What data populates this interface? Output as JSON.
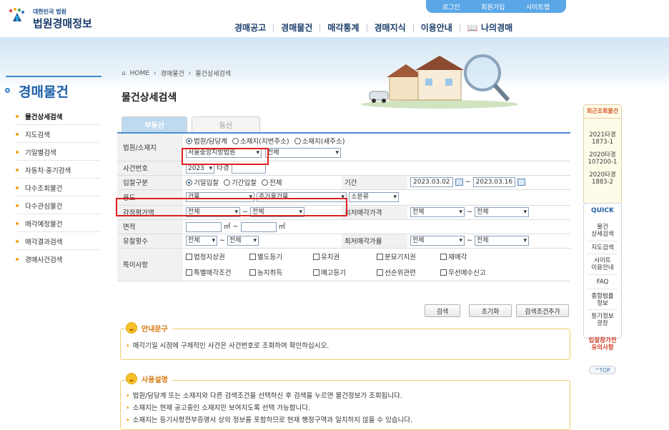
{
  "util_links": [
    "로그인",
    "회원가입",
    "사이트맵"
  ],
  "logo": {
    "small": "대한민국 법원",
    "big": "법원경매정보"
  },
  "gnb": [
    "경매공고",
    "경매물건",
    "매각통계",
    "경매지식",
    "이용안내",
    "나의경매"
  ],
  "breadcrumb": [
    "HOME",
    "경매물건",
    "물건상세검색"
  ],
  "lnb": {
    "title": "경매물건",
    "items": [
      "물건상세검색",
      "지도검색",
      "기일별검색",
      "자동차·중기검색",
      "다수조회물건",
      "다수관심물건",
      "매각예정물건",
      "매각결과검색",
      "경매사건검색"
    ]
  },
  "page_title": "물건상세검색",
  "tabs": [
    "부동산",
    "동산"
  ],
  "form": {
    "court_label": "법원/소재지",
    "radio_court": "법원/담당계",
    "radio_addr_old": "소재지(지번주소)",
    "radio_addr_new": "소재지(새주소)",
    "court_select": "서울중앙지방법원",
    "court_sub_select": "전체",
    "case_label": "사건번호",
    "case_year": "2023",
    "case_suffix": "타경",
    "bid_label": "입찰구분",
    "bid_opt1": "기일입찰",
    "bid_opt2": "기간입찰",
    "bid_opt3": "전체",
    "period_label": "기간",
    "date_from": "2023.03.02",
    "date_to": "2023.03.16",
    "tilde": "~",
    "use_label": "용도",
    "use_1": "건물",
    "use_2": "주거용건물",
    "use_3": "소분류",
    "appraisal_label": "감정평가액",
    "appraisal_from": "전체",
    "appraisal_to": "전체",
    "minprice_label": "최저매각가격",
    "minprice_from": "전체",
    "minprice_to": "전체",
    "area_label": "면적",
    "area_unit": "㎡",
    "fail_label": "유찰횟수",
    "fail_from": "전체",
    "fail_to": "전체",
    "minrate_label": "최저매각가율",
    "minrate_from": "전체",
    "minrate_to": "전체",
    "special_label": "특이사항",
    "special_row1": [
      "법정지상권",
      "별도등기",
      "유치권",
      "분묘기지권",
      "재매각"
    ],
    "special_row2": [
      "특별매각조건",
      "농지취득",
      "예고등기",
      "선순위관련",
      "우선매수신고"
    ]
  },
  "buttons": {
    "search": "검색",
    "reset": "초기화",
    "add": "검색조건추가"
  },
  "notice": {
    "title": "안내문구",
    "text": "매각기일 시점에 구체적인 사건은 사건번호로 조회하여 확인하십시오."
  },
  "usage": {
    "title": "사용설명",
    "lines": [
      "법원/담당계 또는 소재지와 다른 검색조건을 선택하신 후 검색을 누르면 물건정보가 조회됩니다.",
      "소재지는 현재 공고중인 소재지만 보여지도록 선택 가능합니다.",
      "소재지는 등기사항전부증명서 상의 정보를 포함하므로 현재 행정구역과 일치하지 않을 수 있습니다."
    ]
  },
  "recent": {
    "title": "최근조회물건",
    "items": [
      "2021타경\n1873-1",
      "2020타경\n107200-1",
      "2020타경\n1883-2"
    ]
  },
  "quick": {
    "title": "QUICK",
    "items": [
      "물건\n상세검색",
      "지도검색",
      "사이트\n이용안내",
      "FAQ",
      "종합법률\n정보",
      "등기정보\n광장"
    ]
  },
  "warn": "입찰참가전\n유의사항",
  "totop": "^TOP",
  "colors": {
    "accent": "#1d5fa6",
    "highlight": "#e02020",
    "util_bar": "#5aa6e6"
  }
}
